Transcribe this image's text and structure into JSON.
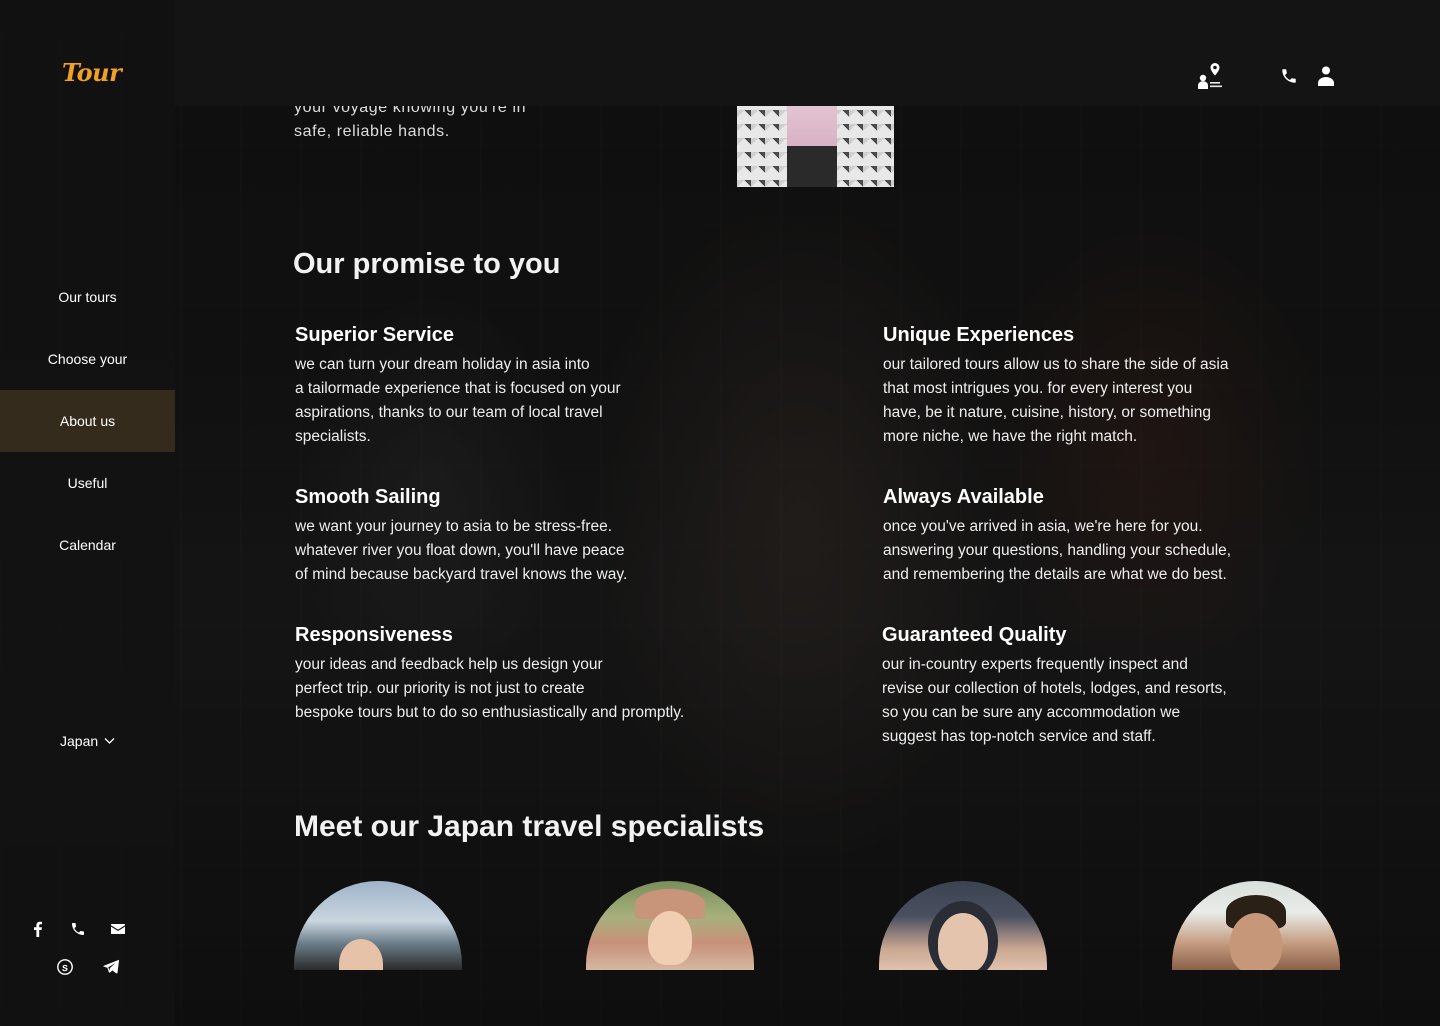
{
  "brand": {
    "logo_text": "Tour",
    "accent_color": "#f0a024"
  },
  "sidebar": {
    "nav_items": [
      {
        "label": "Our tours",
        "active": false
      },
      {
        "label": "Choose your",
        "active": false
      },
      {
        "label": "About us",
        "active": true
      },
      {
        "label": "Useful",
        "active": false
      },
      {
        "label": "Calendar",
        "active": false
      }
    ],
    "country_selector": {
      "selected": "Japan",
      "icon": "chevron-down-icon"
    },
    "social_icons": [
      "facebook-icon",
      "phone-icon",
      "email-icon",
      "skype-icon",
      "telegram-icon"
    ]
  },
  "header": {
    "icons": [
      "map-pin-icon",
      "phone-icon",
      "user-icon"
    ]
  },
  "intro": {
    "lines": [
      "your voyage knowing you're in",
      "safe, reliable hands."
    ]
  },
  "promise": {
    "title": "Our promise to you",
    "features": [
      {
        "title": "Superior Service",
        "lines": [
          "we can turn your dream holiday in asia into",
          "a tailormade experience that is focused on your",
          "aspirations, thanks to our team of local travel",
          "specialists."
        ]
      },
      {
        "title": "Unique Experiences",
        "lines": [
          "our tailored tours allow us to share the side of asia",
          "that most intrigues you. for every interest you",
          "have, be it nature, cuisine, history, or something",
          "more niche, we have the right match."
        ]
      },
      {
        "title": "Smooth Sailing",
        "lines": [
          "we want your journey to asia to be stress-free.",
          "whatever river you float down, you'll have peace",
          "of mind because backyard travel knows the way."
        ]
      },
      {
        "title": "Always Available",
        "lines": [
          "once you've arrived in asia, we're here for you.",
          "answering your questions, handling your schedule,",
          "and remembering the details are what we do best."
        ]
      },
      {
        "title": "Responsiveness",
        "lines": [
          "your ideas and feedback help us design your",
          "perfect trip. our priority is not just to create",
          "bespoke tours but to do so enthusiastically and promptly."
        ]
      },
      {
        "title": "Guaranteed Quality",
        "lines": [
          "our in-country experts frequently inspect and",
          "revise our collection of hotels, lodges, and resorts,",
          "so you can be sure any accommodation we",
          "suggest has top-notch service and staff."
        ]
      }
    ]
  },
  "specialists": {
    "title": "Meet our Japan travel specialists"
  }
}
